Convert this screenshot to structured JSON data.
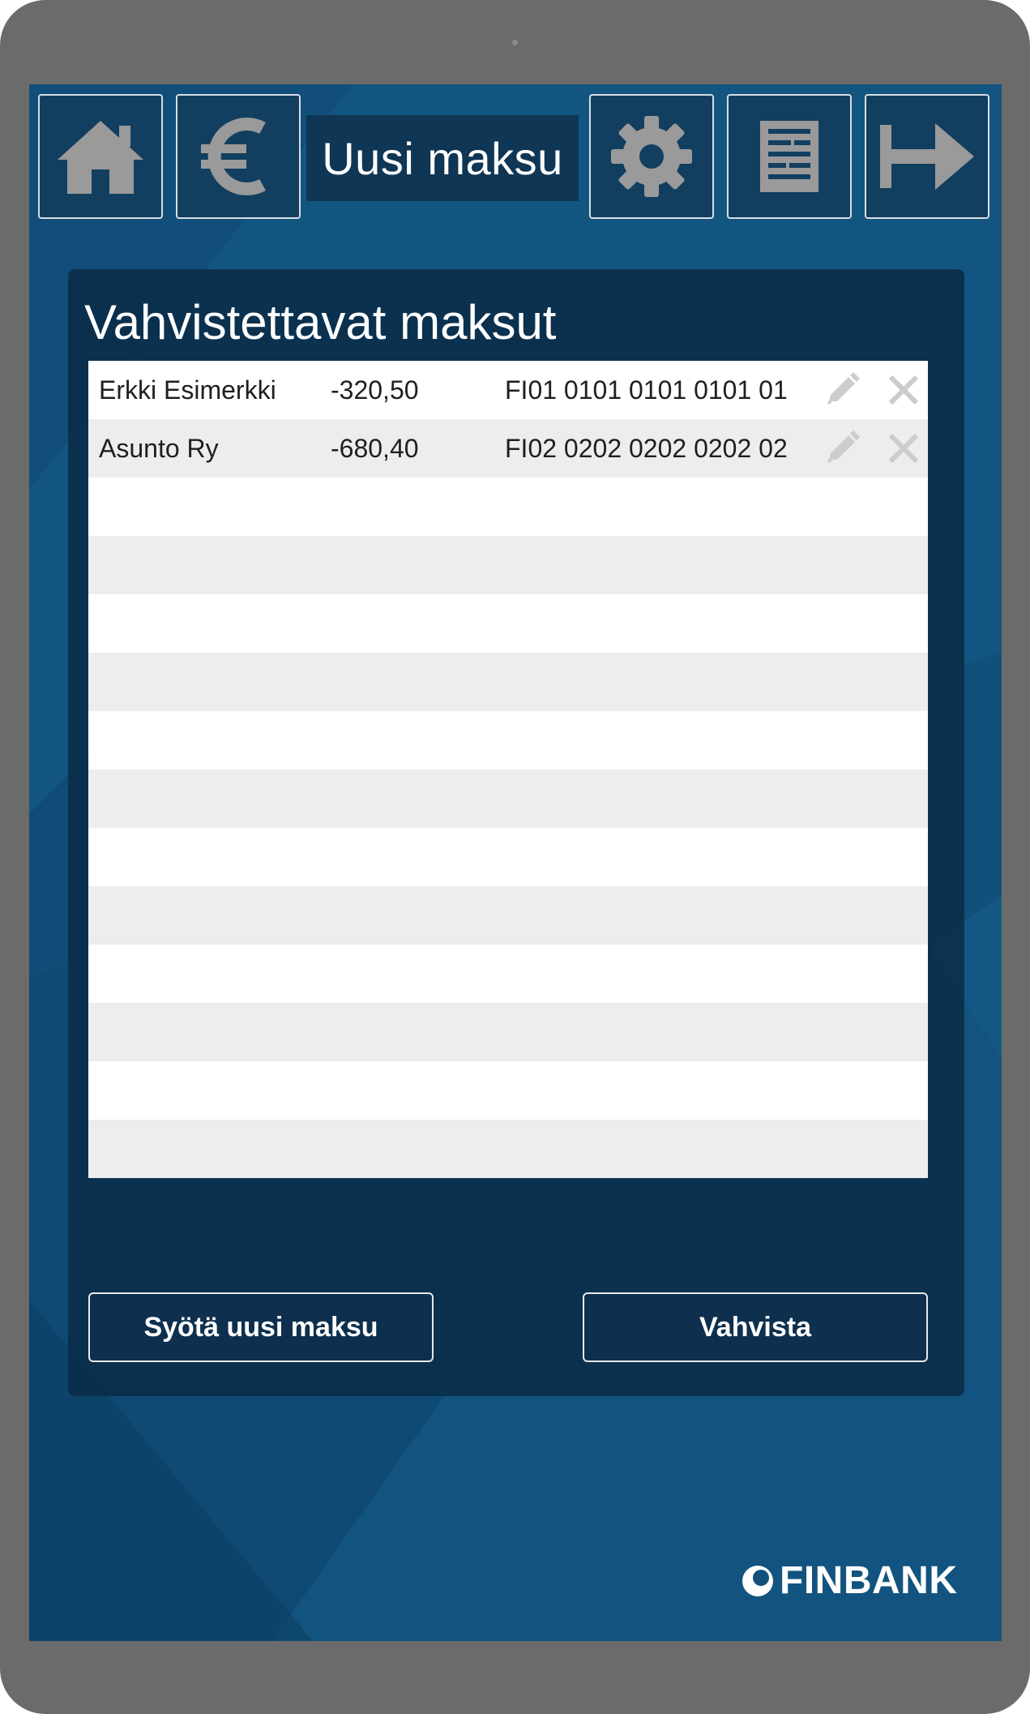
{
  "header": {
    "title": "Uusi maksu",
    "buttons": [
      {
        "icon": "home-icon"
      },
      {
        "icon": "euro-icon"
      },
      {
        "icon": "gear-icon"
      },
      {
        "icon": "document-icon"
      },
      {
        "icon": "logout-arrow-icon"
      }
    ]
  },
  "panel": {
    "title": "Vahvistettavat maksut",
    "rows": [
      {
        "name": "Erkki Esimerkki",
        "amount": "-320,50",
        "iban": "FI01 0101 0101 0101 01"
      },
      {
        "name": "Asunto Ry",
        "amount": "-680,40",
        "iban": "FI02 0202 0202 0202 02"
      }
    ],
    "row_icons": [
      "pencil-icon",
      "close-icon"
    ]
  },
  "actions": {
    "new_payment_label": "Syötä uusi maksu",
    "confirm_label": "Vahvista"
  },
  "brand": {
    "name": "FINBANK"
  },
  "colors": {
    "background": "#11507a",
    "panel": "#0a2c48",
    "button": "#0e304e",
    "icon_gray": "#9a9a9a",
    "row_alt": "#ededed"
  }
}
